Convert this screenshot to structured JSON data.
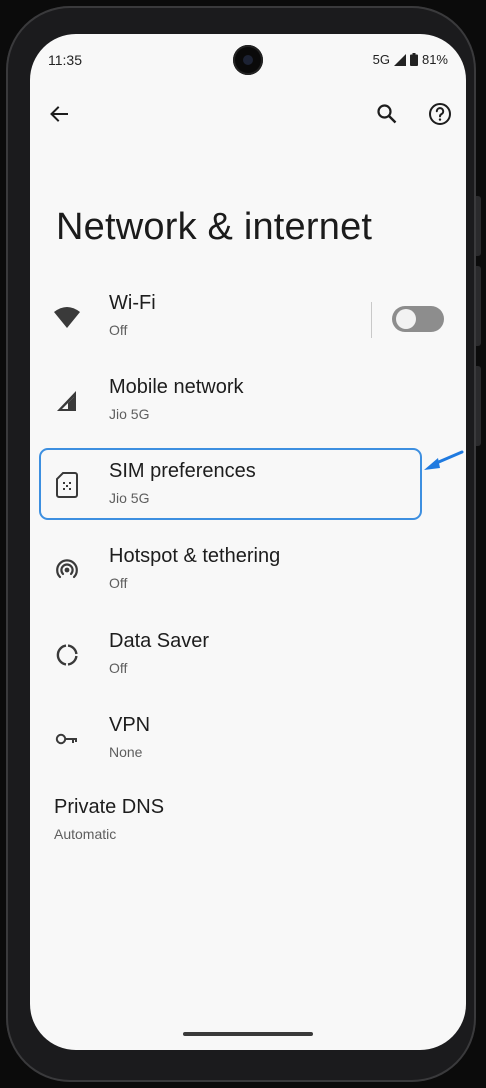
{
  "status_bar": {
    "time": "11:35",
    "network": "5G",
    "battery": "81%"
  },
  "app_bar": {
    "back_icon": "back-arrow-icon",
    "search_icon": "search-icon",
    "help_icon": "help-icon"
  },
  "page_title": "Network & internet",
  "items": [
    {
      "title": "Wi-Fi",
      "subtitle": "Off",
      "icon": "wifi-icon",
      "toggle": false
    },
    {
      "title": "Mobile network",
      "subtitle": "Jio 5G",
      "icon": "signal-icon"
    },
    {
      "title": "SIM preferences",
      "subtitle": "Jio 5G",
      "icon": "sim-card-icon",
      "highlighted": true
    },
    {
      "title": "Hotspot & tethering",
      "subtitle": "Off",
      "icon": "hotspot-icon"
    },
    {
      "title": "Data Saver",
      "subtitle": "Off",
      "icon": "data-saver-icon"
    },
    {
      "title": "VPN",
      "subtitle": "None",
      "icon": "vpn-key-icon"
    },
    {
      "title": "Private DNS",
      "subtitle": "Automatic"
    }
  ],
  "colors": {
    "highlight": "#3d8fe0",
    "arrow": "#1f7ae0",
    "background": "#f8f8f8"
  }
}
